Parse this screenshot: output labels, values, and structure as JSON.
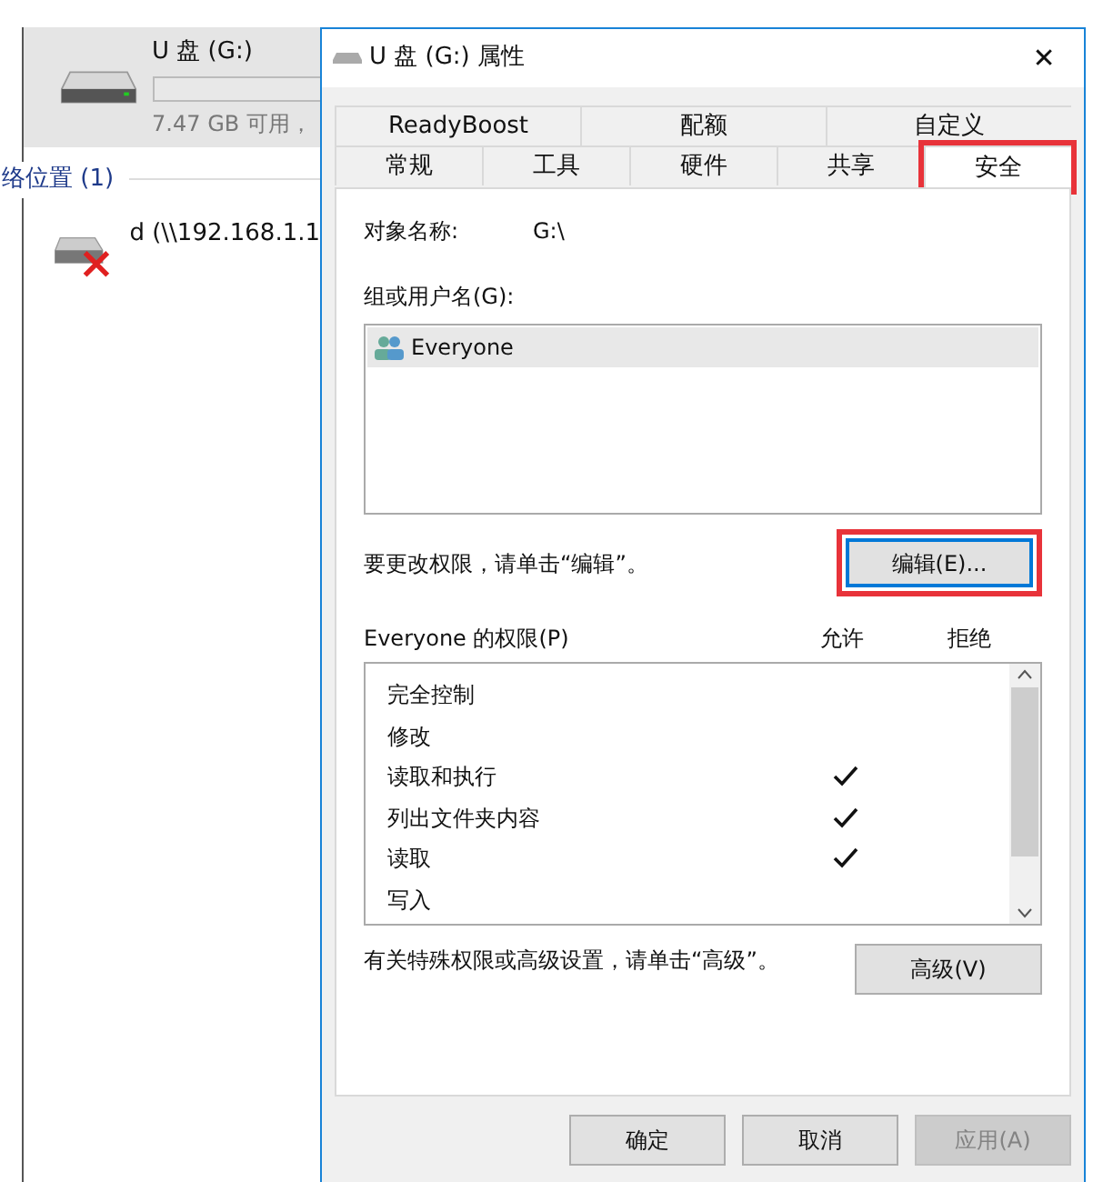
{
  "explorer": {
    "drive": {
      "name": "U 盘 (G:)",
      "space": "7.47 GB 可用，"
    },
    "section": "络位置 (1)",
    "network_drive": {
      "name": "d (\\\\192.168.1.1",
      "disconnected": true
    }
  },
  "dialog": {
    "title": "U 盘 (G:) 属性",
    "close": "✕",
    "tab_rows": [
      [
        {
          "label": "ReadyBoost",
          "selected": false,
          "highlighted": false
        },
        {
          "label": "配额",
          "selected": false,
          "highlighted": false
        },
        {
          "label": "自定义",
          "selected": false,
          "highlighted": false
        }
      ],
      [
        {
          "label": "常规",
          "selected": false,
          "highlighted": false
        },
        {
          "label": "工具",
          "selected": false,
          "highlighted": false
        },
        {
          "label": "硬件",
          "selected": false,
          "highlighted": false
        },
        {
          "label": "共享",
          "selected": false,
          "highlighted": false
        },
        {
          "label": "安全",
          "selected": true,
          "highlighted": true
        }
      ]
    ],
    "object_label": "对象名称:",
    "object_value": "G:\\",
    "groups_label": "组或用户名(G):",
    "groups": [
      {
        "name": "Everyone",
        "selected": true
      }
    ],
    "edit_hint": "要更改权限，请单击“编辑”。",
    "edit_button": {
      "label": "编辑(E)...",
      "highlighted": true
    },
    "permissions_label": "Everyone 的权限(P)",
    "allow_header": "允许",
    "deny_header": "拒绝",
    "permissions": [
      {
        "name": "完全控制",
        "allow": false,
        "deny": false
      },
      {
        "name": "修改",
        "allow": false,
        "deny": false
      },
      {
        "name": "读取和执行",
        "allow": true,
        "deny": false
      },
      {
        "name": "列出文件夹内容",
        "allow": true,
        "deny": false
      },
      {
        "name": "读取",
        "allow": true,
        "deny": false
      },
      {
        "name": "写入",
        "allow": false,
        "deny": false
      }
    ],
    "advanced_hint": "有关特殊权限或高级设置，请单击“高级”。",
    "advanced_button": "高级(V)",
    "buttons": [
      {
        "label": "确定",
        "disabled": false
      },
      {
        "label": "取消",
        "disabled": false
      },
      {
        "label": "应用(A)",
        "disabled": true
      }
    ]
  }
}
